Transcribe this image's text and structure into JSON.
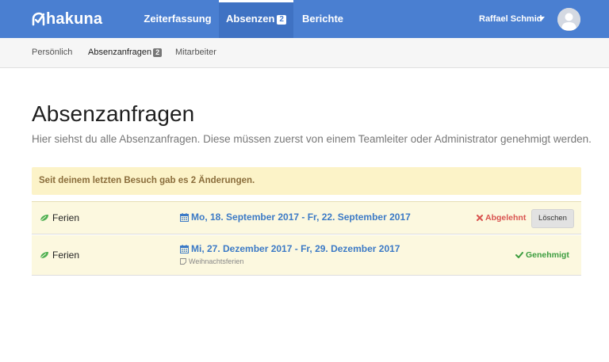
{
  "brand": {
    "logo_text": "hakuna"
  },
  "nav": {
    "items": [
      {
        "label": "Zeiterfassung"
      },
      {
        "label": "Absenzen",
        "badge": "2"
      },
      {
        "label": "Berichte"
      }
    ]
  },
  "user": {
    "name": "Raffael Schmid"
  },
  "subnav": {
    "items": [
      {
        "label": "Persönlich"
      },
      {
        "label": "Absenzanfragen",
        "badge": "2"
      },
      {
        "label": "Mitarbeiter"
      }
    ]
  },
  "page": {
    "title": "Absenzanfragen",
    "subtitle": "Hier siehst du alle Absenzanfragen. Diese müssen zuerst von einem Teamleiter oder Administrator genehmigt werden."
  },
  "alert": {
    "text": "Seit deinem letzten Besuch gab es 2 Änderungen."
  },
  "requests": [
    {
      "type": "Ferien",
      "date_range": "Mo, 18. September 2017 - Fr, 22. September 2017",
      "note": "",
      "status": "Abgelehnt",
      "status_color": "#D9534F",
      "action_label": "Löschen"
    },
    {
      "type": "Ferien",
      "date_range": "Mi, 27. Dezember 2017 - Fr, 29. Dezember 2017",
      "note": "Weihnachtsferien",
      "status": "Genehmigt",
      "status_color": "#3C9D3F",
      "action_label": ""
    }
  ],
  "colors": {
    "header": "#4A7FD1",
    "link": "#3C7AC6",
    "alert_bg": "#FCF3C8",
    "row_bg": "#FCF8DF",
    "leaf": "#4CAF50"
  },
  "icons": {
    "leaf": "leaf-icon",
    "calendar": "calendar-icon",
    "note": "note-icon",
    "rejected": "times-icon",
    "approved": "check-icon"
  }
}
